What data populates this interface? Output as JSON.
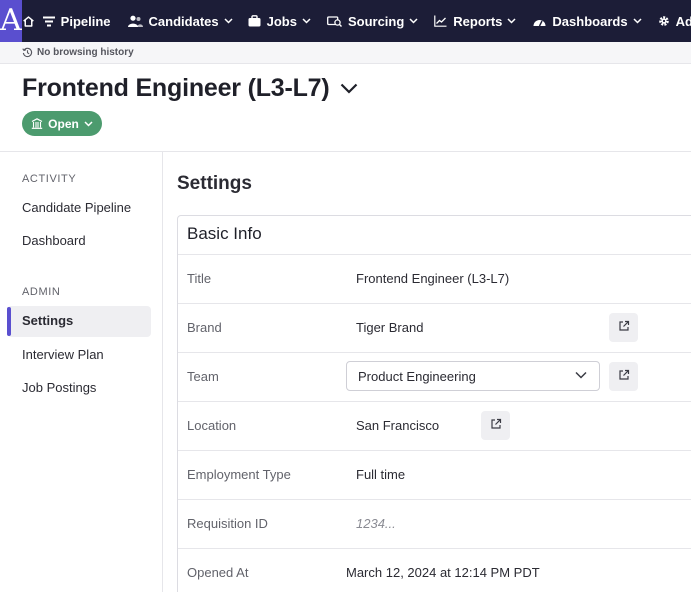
{
  "nav": {
    "logo": "A",
    "items": [
      {
        "label": "Pipeline",
        "icon": "filter-icon",
        "has_chevron": false
      },
      {
        "label": "Candidates",
        "icon": "people-icon",
        "has_chevron": true
      },
      {
        "label": "Jobs",
        "icon": "briefcase-icon",
        "has_chevron": true
      },
      {
        "label": "Sourcing",
        "icon": "sourcing-icon",
        "has_chevron": true
      },
      {
        "label": "Reports",
        "icon": "chart-icon",
        "has_chevron": true
      },
      {
        "label": "Dashboards",
        "icon": "gauge-icon",
        "has_chevron": true
      },
      {
        "label": "Admin",
        "icon": "gear-icon",
        "has_chevron": false
      }
    ]
  },
  "history": {
    "text": "No browsing history"
  },
  "header": {
    "title": "Frontend Engineer (L3-L7)",
    "status": "Open"
  },
  "sidebar": {
    "sections": [
      {
        "heading": "ACTIVITY",
        "items": [
          "Candidate Pipeline",
          "Dashboard"
        ]
      },
      {
        "heading": "ADMIN",
        "items": [
          "Settings",
          "Interview Plan",
          "Job Postings"
        ]
      }
    ],
    "active_item": "Settings"
  },
  "main": {
    "title": "Settings",
    "card_title": "Basic Info",
    "rows": [
      {
        "label": "Title",
        "value": "Frontend Engineer (L3-L7)"
      },
      {
        "label": "Brand",
        "value": "Tiger Brand"
      },
      {
        "label": "Team",
        "value": "Product Engineering"
      },
      {
        "label": "Location",
        "value": "San Francisco"
      },
      {
        "label": "Employment Type",
        "value": "Full time"
      },
      {
        "label": "Requisition ID",
        "value": "1234..."
      },
      {
        "label": "Opened At",
        "value": "March 12, 2024 at 12:14 PM PDT"
      }
    ]
  },
  "colors": {
    "nav_bg": "#1c1d37",
    "accent": "#5a4fcf",
    "status_open": "#4c9b6e"
  }
}
